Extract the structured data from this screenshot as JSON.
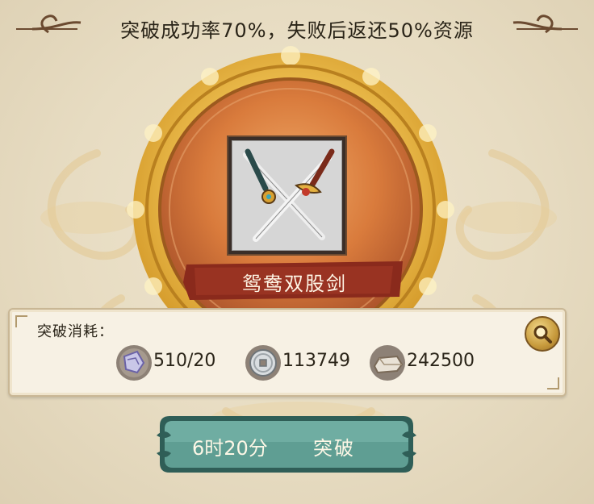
{
  "banner": {
    "text": "突破成功率70%，失败后返还50%资源"
  },
  "item": {
    "name": "鸳鸯双股剑",
    "icon": "crossed-swords-icon"
  },
  "cost_panel": {
    "label": "突破消耗：",
    "resources": [
      {
        "icon": "fragment-icon",
        "value": "510/20"
      },
      {
        "icon": "copper-coin-icon",
        "value": "113749"
      },
      {
        "icon": "silver-ingot-icon",
        "value": "242500"
      }
    ],
    "magnify_icon": "magnifier-icon"
  },
  "action_button": {
    "time": "6时20分",
    "label": "突破"
  },
  "colors": {
    "button_teal": "#5f9e93",
    "button_border": "#2f5e57",
    "medallion_gold": "#e7b43a",
    "medallion_inner": "#d8793a",
    "nameplate_red": "#8a2a1c"
  }
}
